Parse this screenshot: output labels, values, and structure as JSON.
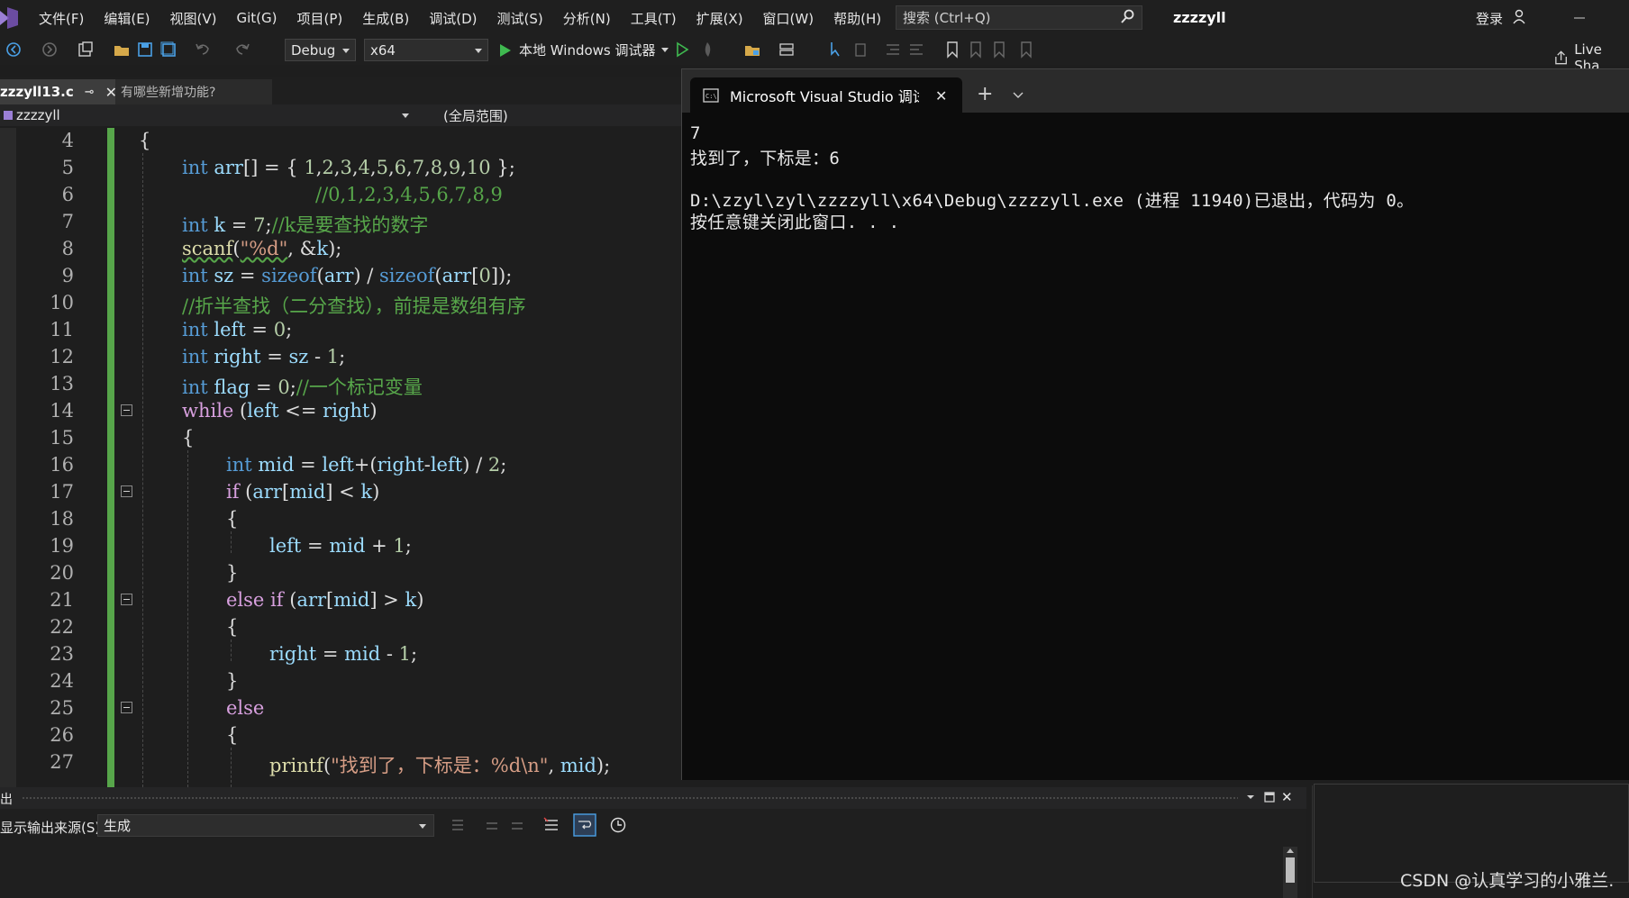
{
  "menubar": {
    "items": [
      "文件(F)",
      "编辑(E)",
      "视图(V)",
      "Git(G)",
      "项目(P)",
      "生成(B)",
      "调试(D)",
      "测试(S)",
      "分析(N)",
      "工具(T)",
      "扩展(X)",
      "窗口(W)",
      "帮助(H)"
    ],
    "search_placeholder": "搜索 (Ctrl+Q)",
    "solution_name": "zzzzyll",
    "login": "登录"
  },
  "toolbar": {
    "config": "Debug",
    "platform": "x64",
    "run_label": "本地 Windows 调试器",
    "live_share": "Live Sha"
  },
  "tabs": {
    "active": "zzzyll13.c",
    "inactive": "有哪些新增功能?"
  },
  "navbar": {
    "project": "zzzzyll",
    "scope": "(全局范围)"
  },
  "editor": {
    "line_numbers": [
      "4",
      "5",
      "6",
      "7",
      "8",
      "9",
      "10",
      "11",
      "12",
      "13",
      "14",
      "15",
      "16",
      "17",
      "18",
      "19",
      "20",
      "21",
      "22",
      "23",
      "24",
      "25",
      "26",
      "27"
    ]
  },
  "console": {
    "title": "Microsoft Visual Studio 调试",
    "lines": [
      "7",
      "找到了，下标是：6",
      "",
      "D:\\zzyl\\zyl\\zzzzyll\\x64\\Debug\\zzzzyll.exe (进程 11940)已退出，代码为 0。",
      "按任意键关闭此窗口. . ."
    ]
  },
  "output": {
    "title": "出",
    "source_label": "显示输出来源(S):",
    "source_value": "生成"
  },
  "watermark": "CSDN @认真学习的小雅兰.",
  "colors": {
    "keyword": "#569cd6",
    "comment": "#57a64a",
    "string": "#d69d85",
    "function": "#dcdcaa",
    "change_bar": "#57a64a"
  }
}
